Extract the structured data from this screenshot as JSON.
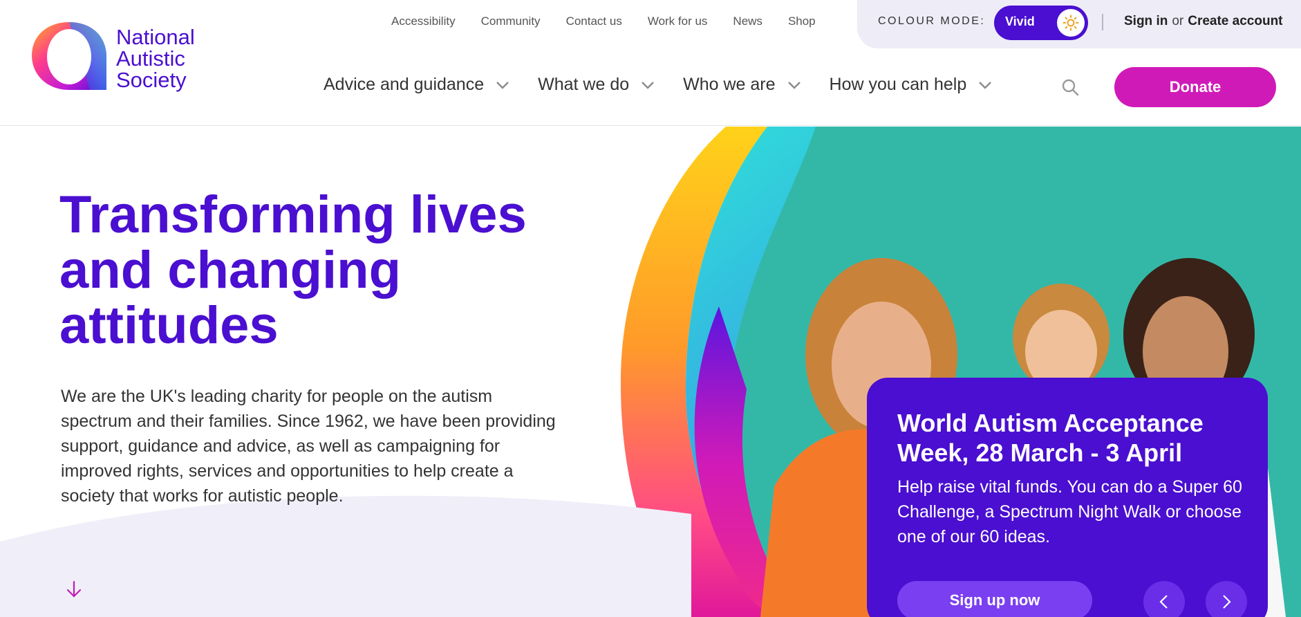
{
  "brand": {
    "name_lines": [
      "National",
      "Autistic",
      "Society"
    ],
    "primary_color": "#4a0fd0",
    "accent_color": "#d01ab8"
  },
  "utility_nav": [
    "Accessibility",
    "Community",
    "Contact us",
    "Work for us",
    "News",
    "Shop"
  ],
  "colour_mode": {
    "label": "COLOUR MODE:",
    "value": "Vivid",
    "icon": "sun-icon"
  },
  "account": {
    "sign_in": "Sign in",
    "or": "or",
    "create_account": "Create account"
  },
  "main_nav": [
    {
      "label": "Advice and guidance",
      "icon": "chevron-down-icon"
    },
    {
      "label": "What we do",
      "icon": "chevron-down-icon"
    },
    {
      "label": "Who we are",
      "icon": "chevron-down-icon"
    },
    {
      "label": "How you can help",
      "icon": "chevron-down-icon"
    }
  ],
  "search": {
    "icon": "search-icon"
  },
  "donate": {
    "label": "Donate"
  },
  "hero": {
    "title": "Transforming lives and changing attitudes",
    "text": "We are the UK's leading charity for people on the autism spectrum and their families. Since 1962, we have been providing support, guidance and advice, as well as campaigning for improved rights, services and opportunities to help create a society that works for autistic people.",
    "scroll_icon": "arrow-down-icon"
  },
  "promo": {
    "title": "World Autism Acceptance Week, 28 March - 3 April",
    "text": "Help raise vital funds. You can do a Super 60 Challenge, a Spectrum Night Walk or choose one of our 60 ideas.",
    "cta": "Sign up now",
    "prev_icon": "chevron-left-icon",
    "next_icon": "chevron-right-icon"
  }
}
